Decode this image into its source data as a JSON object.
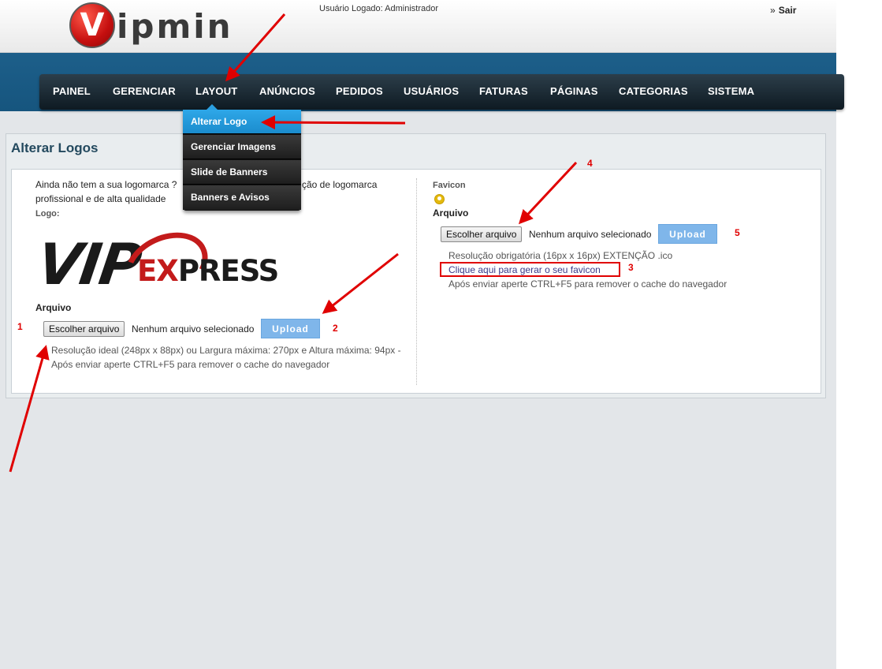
{
  "header": {
    "logo_letter": "V",
    "logo_text": "ipmin",
    "user_logged": "Usuário Logado: Administrador",
    "logout_label": "Sair",
    "logout_prefix": "»"
  },
  "nav": {
    "items": [
      "PAINEL",
      "GERENCIAR",
      "LAYOUT",
      "ANÚNCIOS",
      "PEDIDOS",
      "USUÁRIOS",
      "FATURAS",
      "PÁGINAS",
      "CATEGORIAS",
      "SISTEMA"
    ]
  },
  "dropdown": {
    "items": [
      "Alterar Logo",
      "Gerenciar Imagens",
      "Slide de Banners",
      "Banners e Avisos"
    ],
    "active_index": 0
  },
  "page": {
    "title": "Alterar Logos"
  },
  "logo_section": {
    "intro_line1": "Ainda não tem a sua logomarca ?",
    "intro_line1_tail": "ção de logomarca",
    "intro_line2": "profissional e de alta qualidade",
    "logo_label": "Logo:",
    "logo_image_text": {
      "main": "VIP",
      "e": "E",
      "x": "X",
      "rest": "PRESS"
    },
    "file_heading": "Arquivo",
    "choose_button": "Escolher arquivo",
    "no_file": "Nenhum arquivo selecionado",
    "upload_button": "Upload",
    "hint_line1": "Resolução ideal (248px x 88px) ou Largura máxima: 270px e Altura máxima: 94px -",
    "hint_line2": "Após enviar aperte CTRL+F5 para remover o cache do navegador"
  },
  "favicon_section": {
    "label": "Favicon",
    "icon": "user-circle-icon",
    "file_heading": "Arquivo",
    "choose_button": "Escolher arquivo",
    "no_file": "Nenhum arquivo selecionado",
    "upload_button": "Upload",
    "hint_line1": "Resolução obrigatória (16px x 16px) EXTENÇÃO .ico",
    "generate_link": "Clique aqui para gerar o seu favicon",
    "hint_line2": "Após enviar aperte CTRL+F5 para remover o cache do navegador"
  },
  "annotations": {
    "numbers": [
      "1",
      "2",
      "3",
      "4",
      "5"
    ],
    "color": "#e00000"
  },
  "colors": {
    "accent_blue": "#1d5f8a",
    "active_menu": "#2ea7e8",
    "upload_button": "#7fb6ea",
    "title": "#23495e"
  }
}
